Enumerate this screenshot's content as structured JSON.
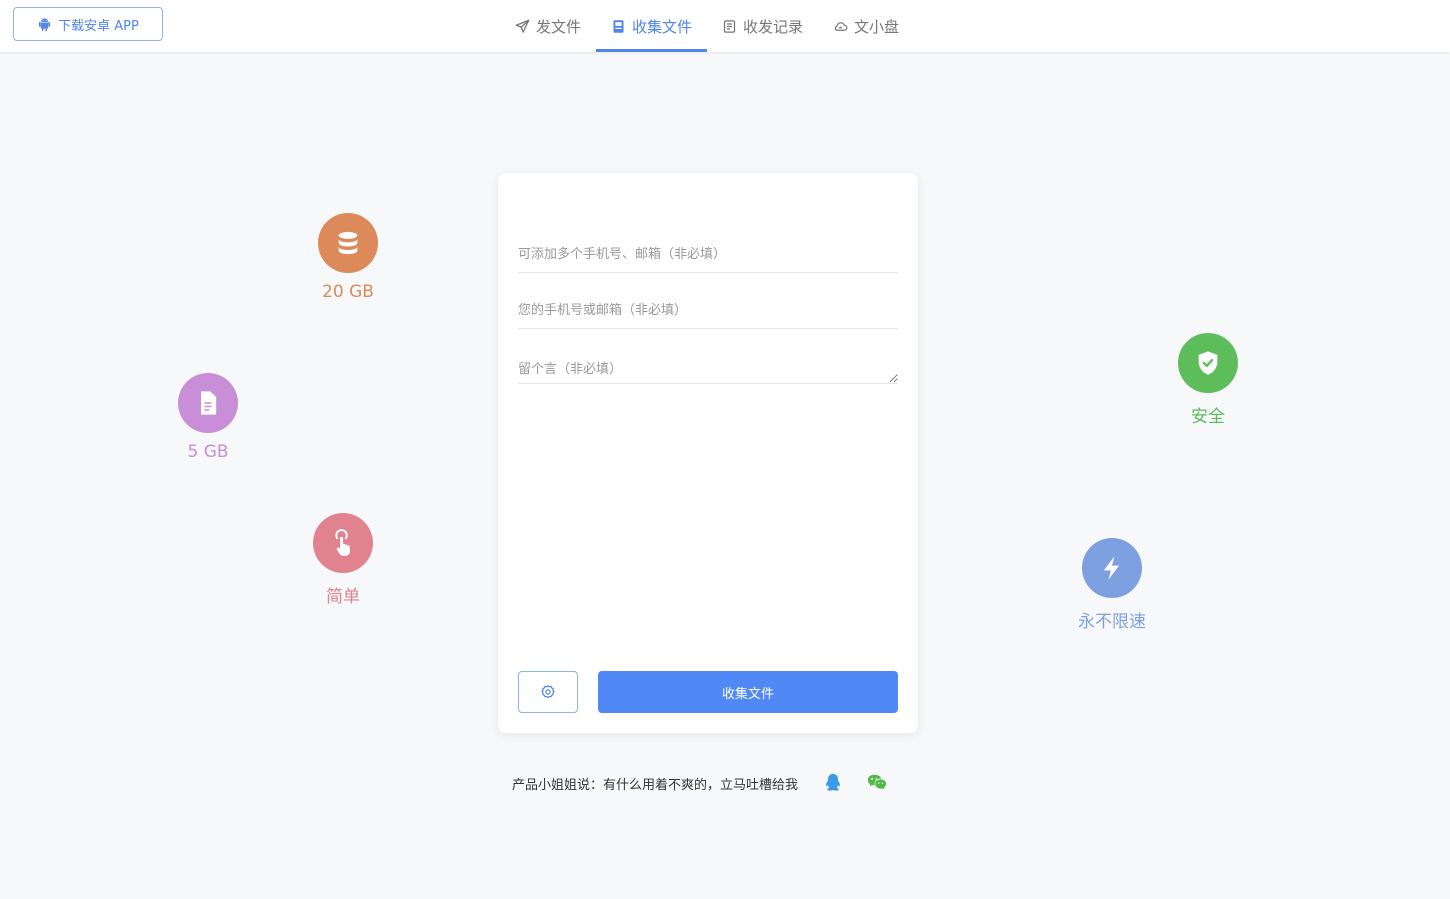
{
  "header": {
    "app_button_label": "下载安卓 APP",
    "app_icon": "android-icon",
    "nav": [
      {
        "label": "发文件",
        "icon": "paper-plane-icon",
        "active": false
      },
      {
        "label": "收集文件",
        "icon": "inbox-icon",
        "active": true
      },
      {
        "label": "收发记录",
        "icon": "record-icon",
        "active": false
      },
      {
        "label": "文小盘",
        "icon": "cloud-icon",
        "active": false
      }
    ]
  },
  "features": [
    {
      "label": "20 GB",
      "icon": "database-icon",
      "color": "#dc8a5a"
    },
    {
      "label": "5 GB",
      "icon": "file-icon",
      "color": "#c88ed8"
    },
    {
      "label": "简单",
      "icon": "pointer-hand-icon",
      "color": "#e0838f"
    },
    {
      "label": "安全",
      "icon": "shield-check-icon",
      "color": "#5cbd5a"
    },
    {
      "label": "永不限速",
      "icon": "lightning-icon",
      "color": "#7ea0e0"
    }
  ],
  "form": {
    "recipients_placeholder": "可添加多个手机号、邮箱（非必填）",
    "sender_placeholder": "您的手机号或邮箱（非必填）",
    "message_placeholder": "留个言（非必填）",
    "settings_icon": "gear-icon",
    "submit_label": "收集文件"
  },
  "footer": {
    "text": "产品小姐姐说：有什么用着不爽的，立马吐槽给我",
    "links": [
      {
        "icon": "qq-icon",
        "color": "#3b9be6"
      },
      {
        "icon": "wechat-icon",
        "color": "#52b84a"
      }
    ]
  },
  "colors": {
    "accent": "#4f86e8",
    "primary_button": "#5088f6",
    "background": "#f7f8fa"
  }
}
